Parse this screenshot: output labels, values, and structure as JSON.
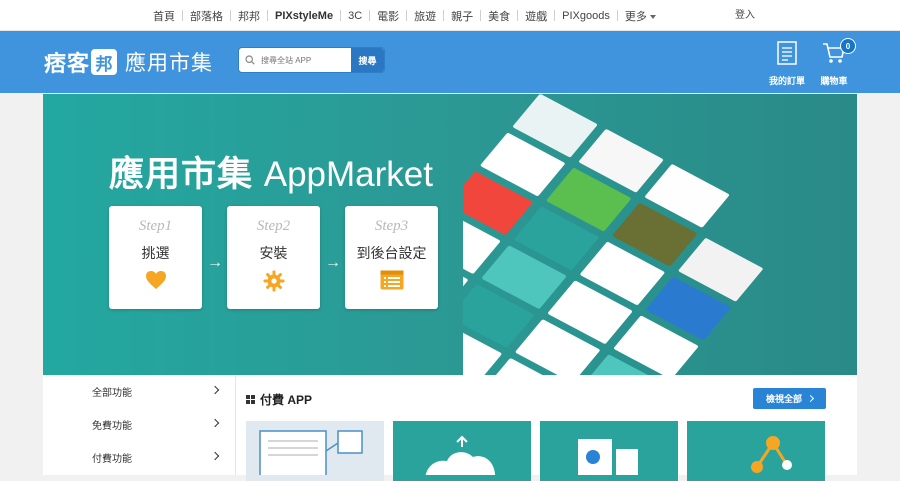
{
  "topnav": {
    "items": [
      {
        "label": "首頁",
        "bold": false
      },
      {
        "label": "部落格",
        "bold": false
      },
      {
        "label": "邦邦",
        "bold": false
      },
      {
        "label": "PIXstyleMe",
        "bold": true
      },
      {
        "label": "3C",
        "bold": false
      },
      {
        "label": "電影",
        "bold": false
      },
      {
        "label": "旅遊",
        "bold": false
      },
      {
        "label": "親子",
        "bold": false
      },
      {
        "label": "美食",
        "bold": false
      },
      {
        "label": "遊戲",
        "bold": false
      },
      {
        "label": "PIXgoods",
        "bold": false
      },
      {
        "label": "更多",
        "bold": false
      }
    ],
    "login": "登入"
  },
  "header": {
    "logo_text_1": "痞客",
    "logo_badge": "邦",
    "logo_sub": "應用市集",
    "search_placeholder": "搜尋全站 APP",
    "search_button": "搜尋",
    "orders_label": "我的訂單",
    "cart_label": "購物車",
    "cart_count": "0"
  },
  "banner": {
    "title_zh": "應用市集",
    "title_en": "AppMarket",
    "steps": [
      {
        "no": "Step1",
        "text": "挑選",
        "icon": "heart-icon"
      },
      {
        "no": "Step2",
        "text": "安裝",
        "icon": "gear-icon"
      },
      {
        "no": "Step3",
        "text": "到後台設定",
        "icon": "list-icon"
      }
    ],
    "arrow": "→"
  },
  "sidebar": {
    "items": [
      {
        "label": "全部功能"
      },
      {
        "label": "免費功能"
      },
      {
        "label": "付費功能"
      }
    ]
  },
  "content": {
    "section_title": "付費 APP",
    "view_all": "檢視全部",
    "card_colors": [
      "#2aa39c",
      "#2aa39c",
      "#2aa39c",
      "#2aa39c"
    ]
  },
  "colors": {
    "header_blue": "#3f94dd",
    "banner_teal": "#2a9f99",
    "accent_orange": "#f5a623",
    "button_blue": "#2a84d6"
  }
}
